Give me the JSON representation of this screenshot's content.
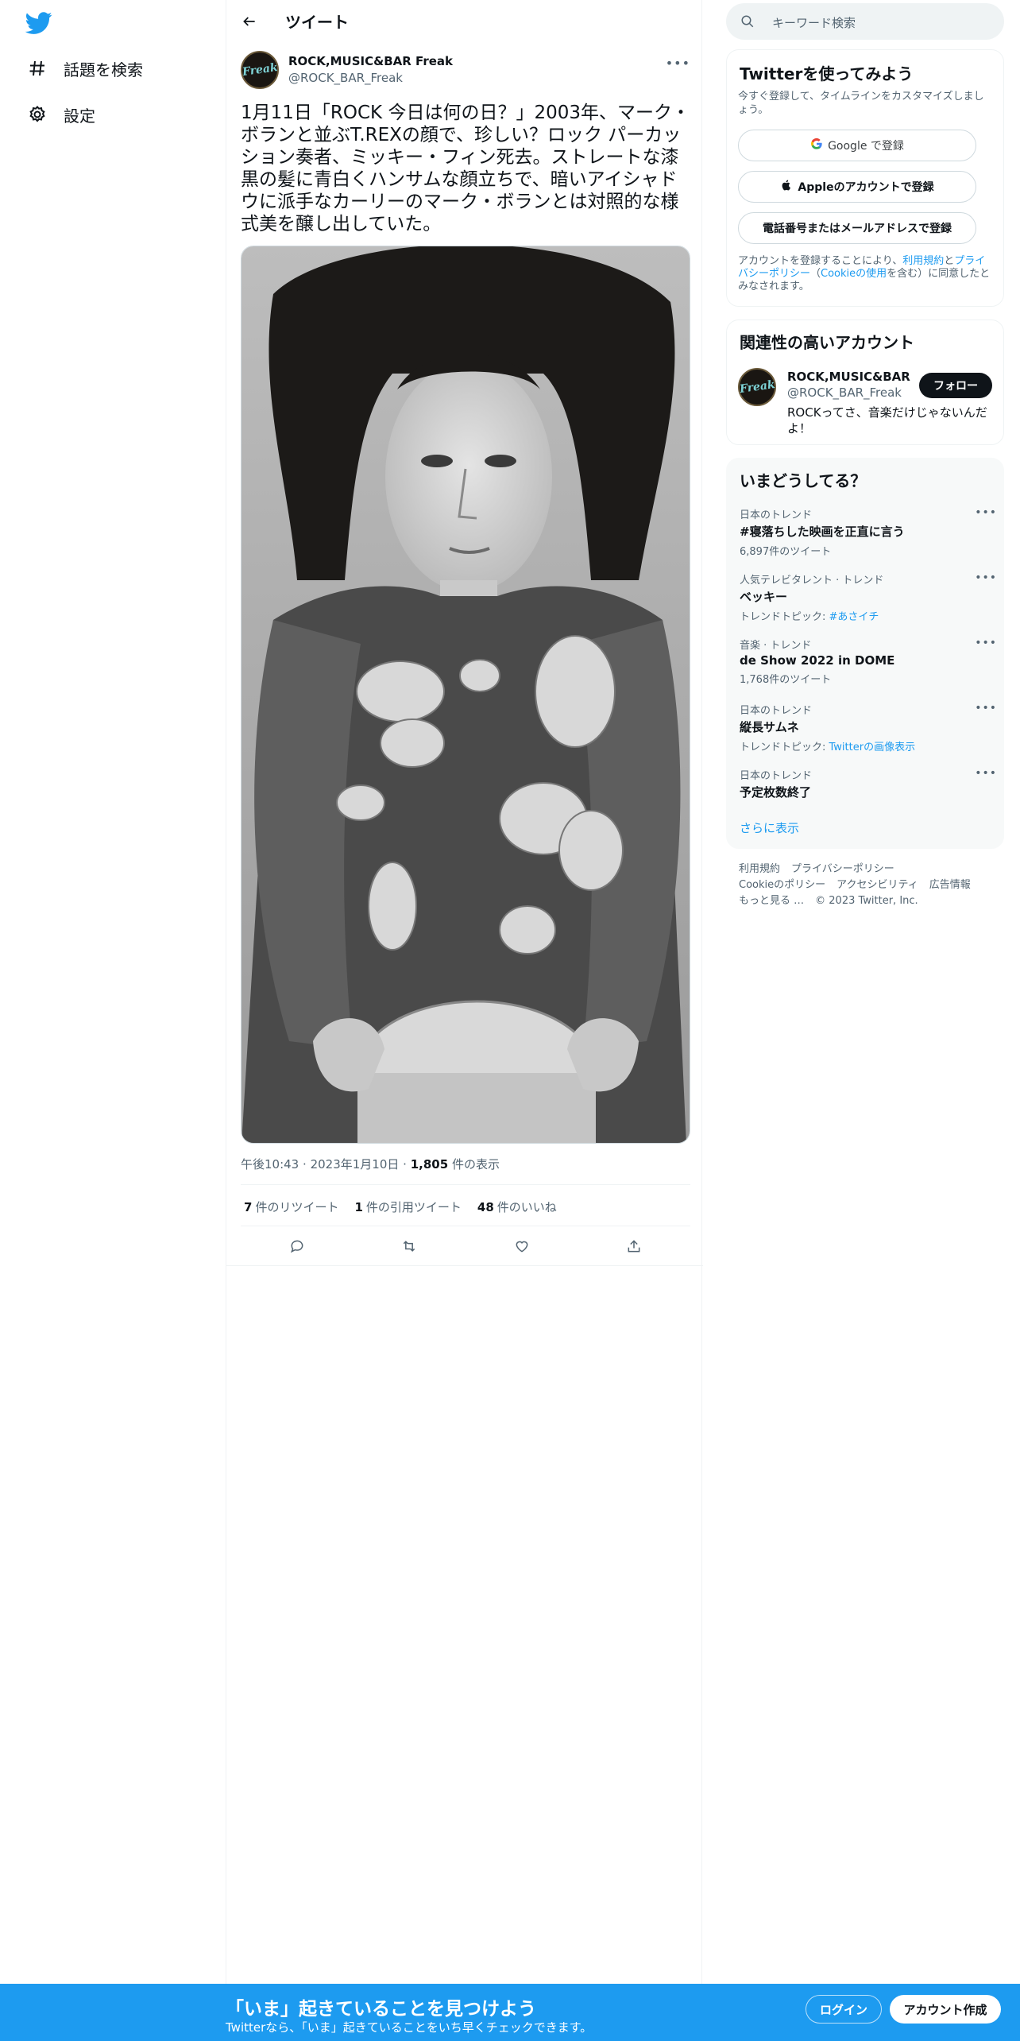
{
  "nav": {
    "items": [
      {
        "label": "話題を検索",
        "icon": "hashtag-icon"
      },
      {
        "label": "設定",
        "icon": "gear-icon"
      }
    ]
  },
  "header": {
    "title": "ツイート"
  },
  "tweet": {
    "author_name": "ROCK,MUSIC&BAR Freak",
    "author_handle": "@ROCK_BAR_Freak",
    "avatar_text": "Freak",
    "text": "1月11日「ROCK 今日は何の日？」2003年、マーク・ボランと並ぶT.REXの顔で、珍しい？ロック パーカッション奏者、ミッキー・フィン死去。ストレートな漆黒の髪に青白くハンサムな顔立ちで、暗いアイシャドウに派手なカーリーのマーク・ボランとは対照的な様式美を醸し出していた。",
    "time": "午後10:43",
    "date": "2023年1月10日",
    "views_count": "1,805",
    "views_label": "件の表示",
    "retweets_count": "7",
    "retweets_label": "件のリツイート",
    "quotes_count": "1",
    "quotes_label": "件の引用ツイート",
    "likes_count": "48",
    "likes_label": "件のいいね"
  },
  "search": {
    "placeholder": "キーワード検索"
  },
  "signup": {
    "title": "Twitterを使ってみよう",
    "subtitle": "今すぐ登録して、タイムラインをカスタマイズしましょう。",
    "google_label": "Google で登録",
    "apple_label": "Appleのアカウントで登録",
    "phone_label": "電話番号またはメールアドレスで登録",
    "legal_1": "アカウントを登録することにより、",
    "legal_terms": "利用規約",
    "legal_2": "と",
    "legal_privacy": "プライバシーポリシー",
    "legal_3": "（",
    "legal_cookie": "Cookieの使用",
    "legal_4": "を含む）に同意したとみなされます。"
  },
  "related": {
    "title": "関連性の高いアカウント",
    "name": "ROCK,MUSIC&BAR ...",
    "handle": "@ROCK_BAR_Freak",
    "bio": "ROCKってさ、音楽だけじゃないんだよ！",
    "follow_label": "フォロー"
  },
  "trends": {
    "title": "いまどうしてる？",
    "items": [
      {
        "context": "日本のトレンド",
        "name": "#寝落ちした映画を正直に言う",
        "count": "6,897件のツイート",
        "topic_label": "",
        "topic_link": ""
      },
      {
        "context": "人気テレビタレント · トレンド",
        "name": "ベッキー",
        "count": "",
        "topic_label": "トレンドトピック: ",
        "topic_link": "#あさイチ"
      },
      {
        "context": "音楽 · トレンド",
        "name": "de Show 2022 in DOME",
        "count": "1,768件のツイート",
        "topic_label": "",
        "topic_link": ""
      },
      {
        "context": "日本のトレンド",
        "name": "縦長サムネ",
        "count": "",
        "topic_label": "トレンドトピック: ",
        "topic_link": "Twitterの画像表示"
      },
      {
        "context": "日本のトレンド",
        "name": "予定枚数終了",
        "count": "",
        "topic_label": "",
        "topic_link": ""
      }
    ],
    "show_more": "さらに表示"
  },
  "footer": {
    "links": [
      "利用規約",
      "プライバシーポリシー",
      "Cookieのポリシー",
      "アクセシビリティ",
      "広告情報",
      "もっと見る …"
    ],
    "copyright": "© 2023 Twitter, Inc."
  },
  "bottombar": {
    "title": "「いま」起きていることを見つけよう",
    "subtitle": "Twitterなら、「いま」起きていることをいち早くチェックできます。",
    "login_label": "ログイン",
    "signup_label": "アカウント作成"
  },
  "colors": {
    "accent": "#1d9bf0",
    "text": "#0f1419",
    "muted": "#536471"
  }
}
